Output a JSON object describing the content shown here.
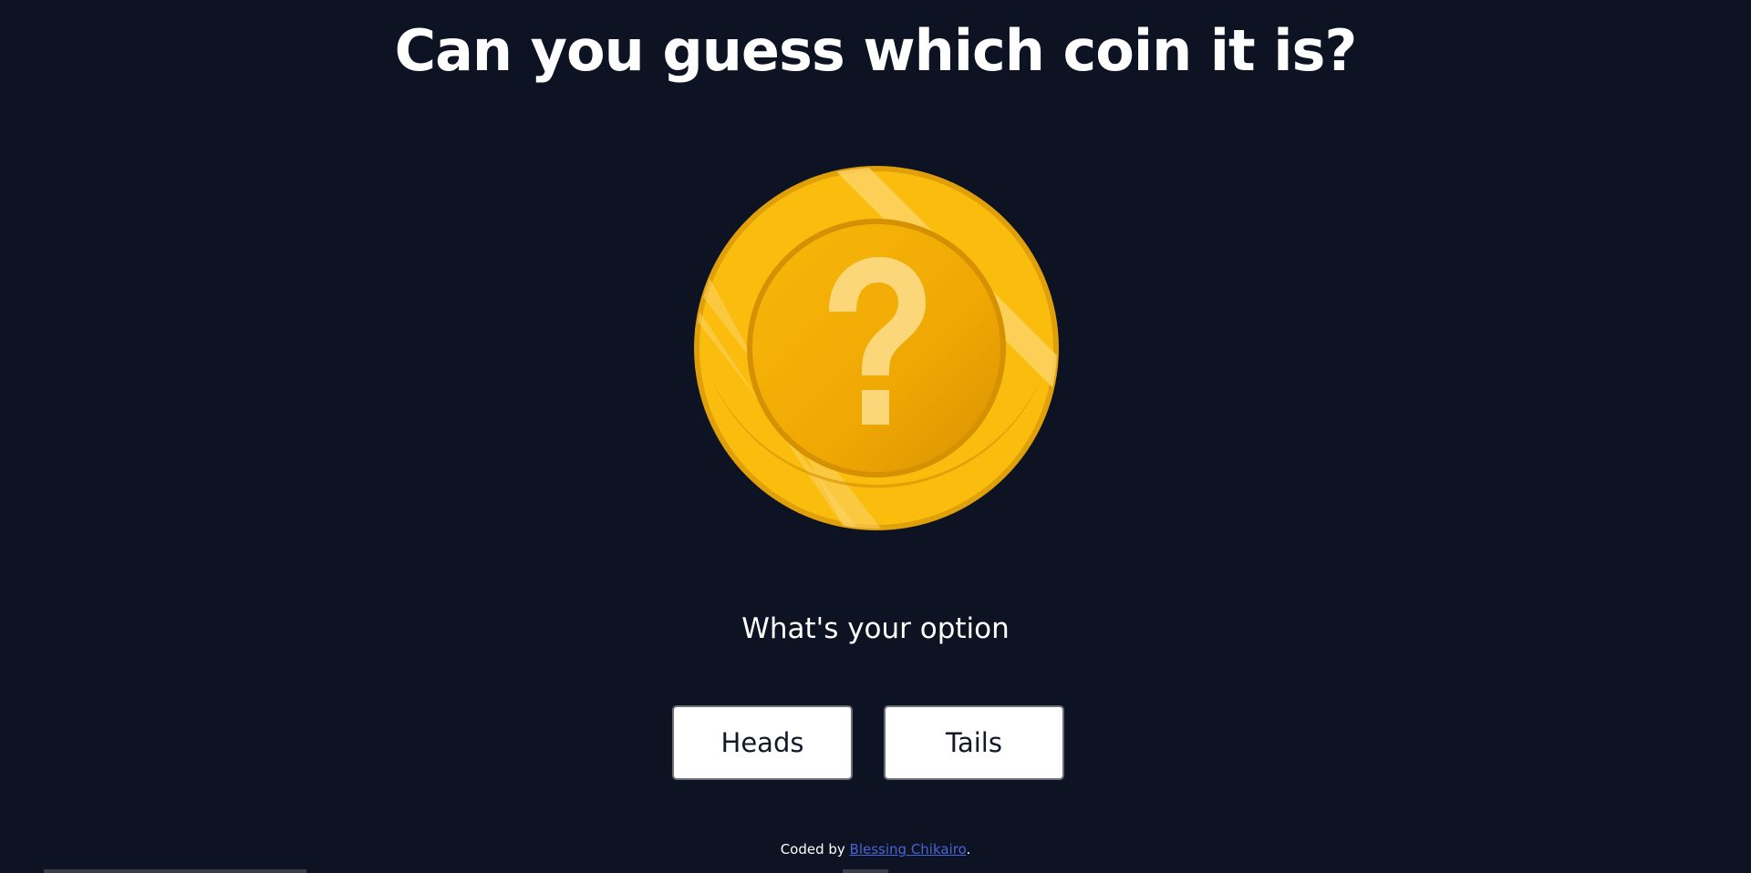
{
  "page": {
    "title": "Can you guess which coin it is?",
    "prompt": "What's your option"
  },
  "coin": {
    "icon": "question-mark-coin-icon",
    "symbol": "?",
    "colors": {
      "rim": "#f5b80c",
      "face": "#f2aa06",
      "mark": "#fbe08a",
      "shadow": "#d48c02"
    }
  },
  "choices": {
    "heads_label": "Heads",
    "tails_label": "Tails"
  },
  "footer": {
    "prefix": "Coded by ",
    "author_link": "Blessing Chikairo",
    "suffix": "."
  },
  "colors": {
    "background": "#0d1322",
    "text": "#ffffff",
    "link": "#4a63d8"
  }
}
